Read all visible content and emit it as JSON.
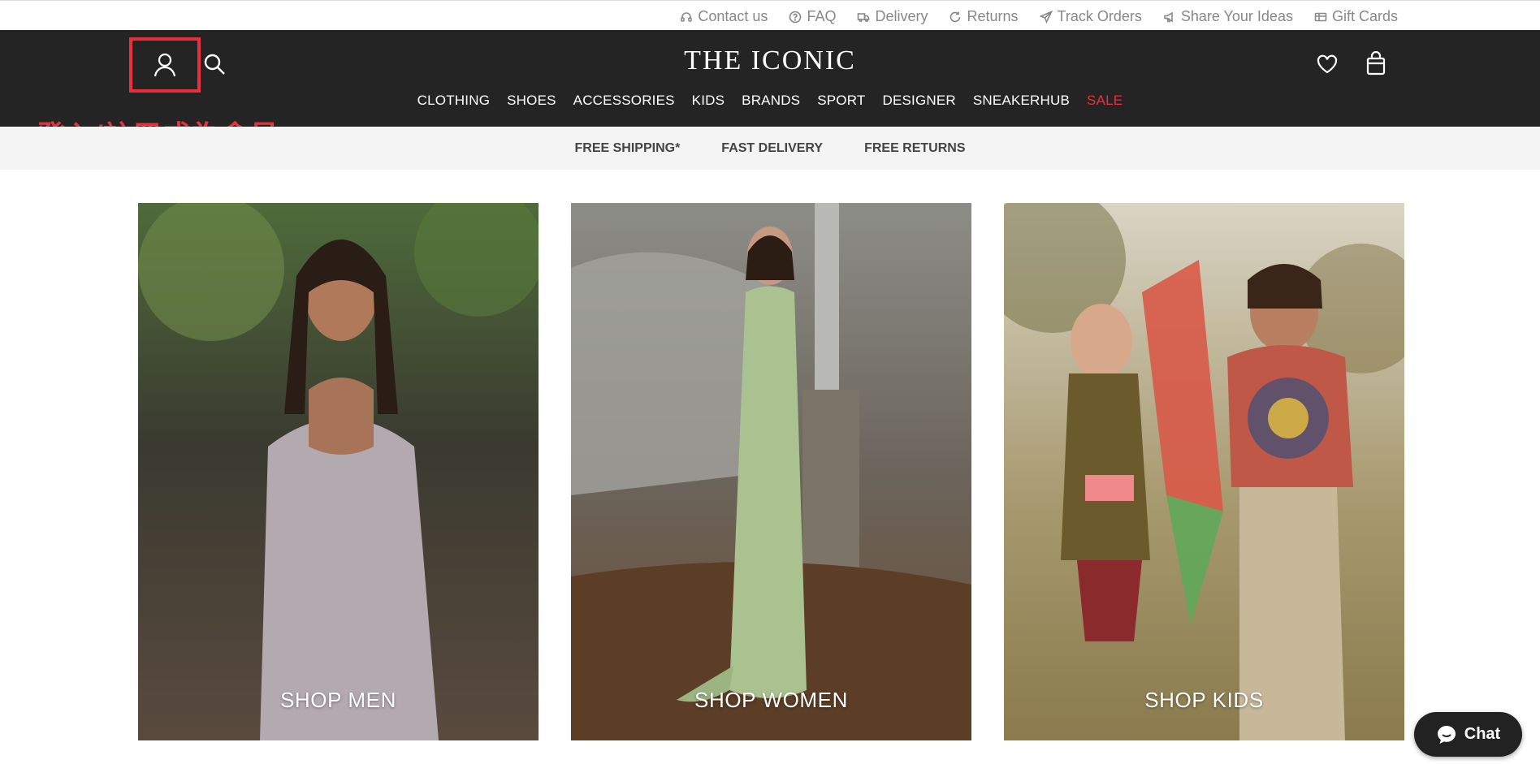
{
  "utility_links": [
    {
      "label": "Contact us",
      "icon": "headset-icon"
    },
    {
      "label": "FAQ",
      "icon": "question-circle-icon"
    },
    {
      "label": "Delivery",
      "icon": "truck-icon"
    },
    {
      "label": "Returns",
      "icon": "return-arrow-icon"
    },
    {
      "label": "Track Orders",
      "icon": "paper-plane-icon"
    },
    {
      "label": "Share Your Ideas",
      "icon": "megaphone-icon"
    },
    {
      "label": "Gift Cards",
      "icon": "gift-card-icon"
    }
  ],
  "header": {
    "logo": "THE ICONIC",
    "nav": [
      "CLOTHING",
      "SHOES",
      "ACCESSORIES",
      "KIDS",
      "BRANDS",
      "SPORT",
      "DESIGNER",
      "SNEAKERHUB",
      "SALE"
    ],
    "sale_color": "#e8313b",
    "background": "#242424"
  },
  "annotation": {
    "text": "登入/註冊成為會員",
    "color": "#e8313b"
  },
  "benefits": [
    "FREE SHIPPING*",
    "FAST DELIVERY",
    "FREE RETURNS"
  ],
  "categories": [
    {
      "label": "SHOP MEN"
    },
    {
      "label": "SHOP WOMEN"
    },
    {
      "label": "SHOP KIDS"
    }
  ],
  "chat": {
    "label": "Chat"
  }
}
